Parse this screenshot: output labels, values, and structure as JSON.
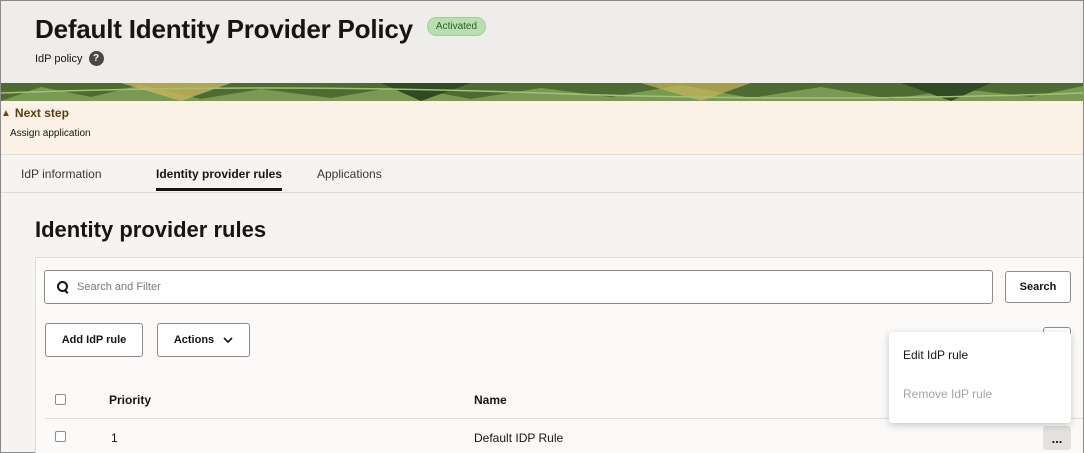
{
  "header": {
    "title": "Default Identity Provider Policy",
    "status_badge": "Activated",
    "subtitle": "IdP policy",
    "help_icon": "?"
  },
  "next_step": {
    "title": "Next step",
    "text": "Assign application",
    "icon": "warning-icon"
  },
  "tabs": [
    {
      "label": "IdP information",
      "active": false
    },
    {
      "label": "Identity provider rules",
      "active": true
    },
    {
      "label": "Applications",
      "active": false
    }
  ],
  "section": {
    "title": "Identity provider rules"
  },
  "search": {
    "placeholder": "Search and Filter",
    "button_label": "Search"
  },
  "toolbar": {
    "add_label": "Add IdP rule",
    "actions_label": "Actions"
  },
  "table": {
    "columns": [
      "Priority",
      "Name"
    ],
    "rows": [
      {
        "priority": "1",
        "name": "Default IDP Rule"
      }
    ]
  },
  "context_menu": {
    "items": [
      {
        "label": "Edit IdP rule",
        "enabled": true
      },
      {
        "label": "Remove IdP rule",
        "enabled": false
      }
    ]
  },
  "row_actions_label": "..."
}
